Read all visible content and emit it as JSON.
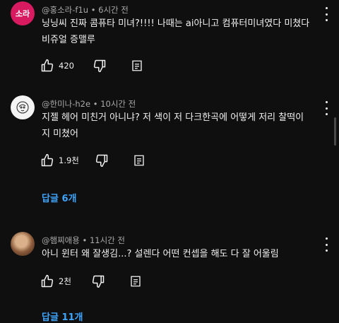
{
  "comments": [
    {
      "avatar_text": "소라",
      "author": "@홍소라-f1u",
      "time": "6시간 전",
      "text": "닝닝씨 진짜 콤퓨타 미녀?!!!! 나때는 ai아니고 컴퓨터미녀였다 미쳤다 비쥬얼 증맬루",
      "likes": "420"
    },
    {
      "author": "@한미나-h2e",
      "time": "10시간 전",
      "text": "지젤 헤어 미친거 아니냐? 저 색이 저 다크한곡에 어떻게 저리 찰떡이지 미쳤어",
      "likes": "1.9천",
      "replies": "답글 6개"
    },
    {
      "author": "@햄찌애용",
      "time": "11시간 전",
      "text": "아니 윈터 왜 잘생김...? 설렌다 어떤 컨셉을 해도 다 잘 어울림",
      "likes": "2천",
      "replies": "답글 11개"
    }
  ],
  "icons": {
    "like": "thumbs-up-icon",
    "dislike": "thumbs-down-icon",
    "reply": "reply-comment-icon",
    "menu": "more-vert-icon"
  },
  "colors": {
    "background": "#0f0f0f",
    "link": "#3ea6ff",
    "avatar_pink": "#d81b60"
  }
}
